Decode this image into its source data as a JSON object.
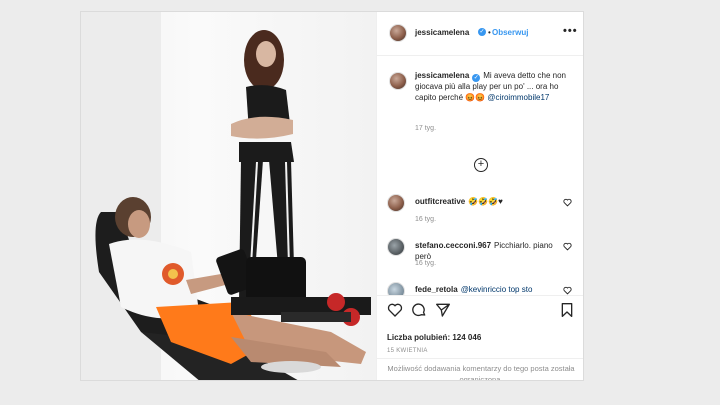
{
  "header": {
    "username": "jessicamelena",
    "verified_badge": "✓",
    "separator": "•",
    "follow_label": "Obserwuj",
    "more_label": "•••"
  },
  "caption": {
    "username": "jessicamelena",
    "text": "Mi aveva detto che non giocava più alla play per un po' ... ora ho capito perché 😡😡",
    "mention": "@ciroimmobile17",
    "time": "17 tyg."
  },
  "load_more": {
    "label": "+",
    "icon": "plus-circle-icon"
  },
  "comments": [
    {
      "username": "outfitcreative",
      "text": "🤣🤣🤣♥",
      "time": "16 tyg."
    },
    {
      "username": "stefano.cecconi.967",
      "text": "Picchiarlo. piano però",
      "time": "16 tyg."
    },
    {
      "username": "fede_retola",
      "text": "@kevinriccio top sto",
      "time": ""
    }
  ],
  "actions": {
    "icons": [
      "heart-icon",
      "comment-icon",
      "share-icon",
      "bookmark-icon"
    ],
    "likes_label": "Liczba polubień:",
    "likes_count": "124 046",
    "date": "15 KWIETNIA"
  },
  "comments_disabled": "Możliwość dodawania komentarzy do tego posta została ograniczona.",
  "colors": {
    "accent": "#3897f0",
    "text": "#262626",
    "muted": "#8e8e8e",
    "border": "#dbdbdb"
  }
}
